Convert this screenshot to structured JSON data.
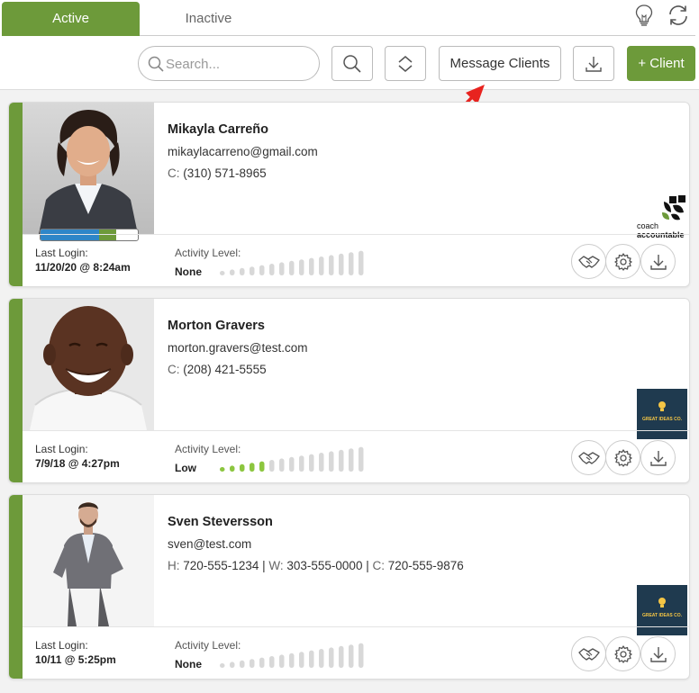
{
  "tabs": [
    {
      "label": "Active",
      "active": true
    },
    {
      "label": "Inactive",
      "active": false
    }
  ],
  "toolbar": {
    "search_placeholder": "Search...",
    "message_clients_label": "Message Clients",
    "add_client_label": "+ Client"
  },
  "icons": {
    "tips": "lightbulb-icon",
    "refresh": "refresh-icon",
    "search": "search-icon",
    "sort": "sort-icon",
    "download": "download-icon",
    "handshake": "handshake-icon",
    "settings": "gear-icon"
  },
  "colors": {
    "accent": "#6d9a3a",
    "meter_active": "#8cc63f",
    "meter_inactive": "#d8d8d8",
    "arrow": "#e8231f"
  },
  "clients": [
    {
      "name": "Mikayla Carreño",
      "email": "mikaylacarreno@gmail.com",
      "phones": [
        {
          "label": "C:",
          "number": "(310) 571-8965"
        }
      ],
      "last_login_label": "Last Login:",
      "last_login": "11/20/20 @ 8:24am",
      "activity_label": "Activity Level:",
      "activity_level": "None",
      "activity_bars_lit": 0,
      "progress_segments": [
        0.6,
        0.18
      ],
      "logo": "coachaccountable",
      "logo_text": [
        "coach",
        "accountable"
      ]
    },
    {
      "name": "Morton Gravers",
      "email": "morton.gravers@test.com",
      "phones": [
        {
          "label": "C:",
          "number": "(208) 421-5555"
        }
      ],
      "last_login_label": "Last Login:",
      "last_login": "7/9/18 @ 4:27pm",
      "activity_label": "Activity Level:",
      "activity_level": "Low",
      "activity_bars_lit": 5,
      "progress_segments": null,
      "logo": "great-ideas",
      "logo_text": [
        "GREAT IDEAS CO."
      ]
    },
    {
      "name": "Sven Steversson",
      "email": "sven@test.com",
      "phones": [
        {
          "label": "H:",
          "number": "720-555-1234"
        },
        {
          "label": "W:",
          "number": "303-555-0000"
        },
        {
          "label": "C:",
          "number": "720-555-9876"
        }
      ],
      "last_login_label": "Last Login:",
      "last_login": "10/11 @ 5:25pm",
      "activity_label": "Activity Level:",
      "activity_level": "None",
      "activity_bars_lit": 0,
      "progress_segments": null,
      "logo": "great-ideas",
      "logo_text": [
        "GREAT IDEAS CO."
      ]
    }
  ]
}
